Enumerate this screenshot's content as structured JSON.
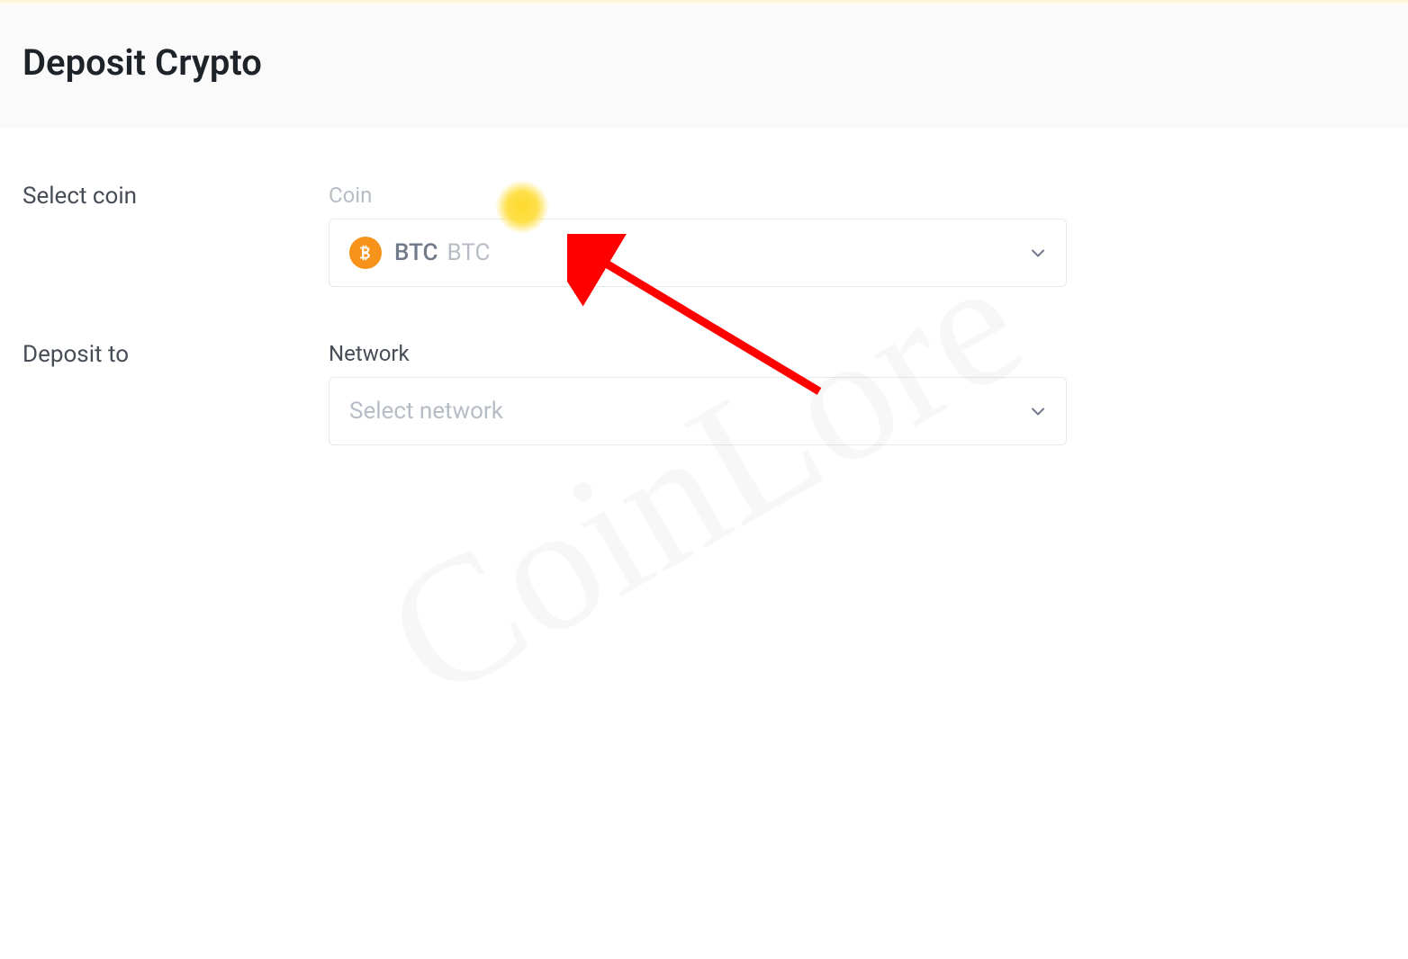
{
  "header": {
    "title": "Deposit Crypto"
  },
  "form": {
    "select_coin": {
      "label": "Select coin",
      "field_label": "Coin",
      "selected": {
        "symbol": "BTC",
        "name": "BTC",
        "icon": "bitcoin-icon",
        "color": "#f7931a"
      }
    },
    "deposit_to": {
      "label": "Deposit to",
      "field_label": "Network",
      "placeholder": "Select network"
    }
  },
  "watermark": "CoinLore"
}
